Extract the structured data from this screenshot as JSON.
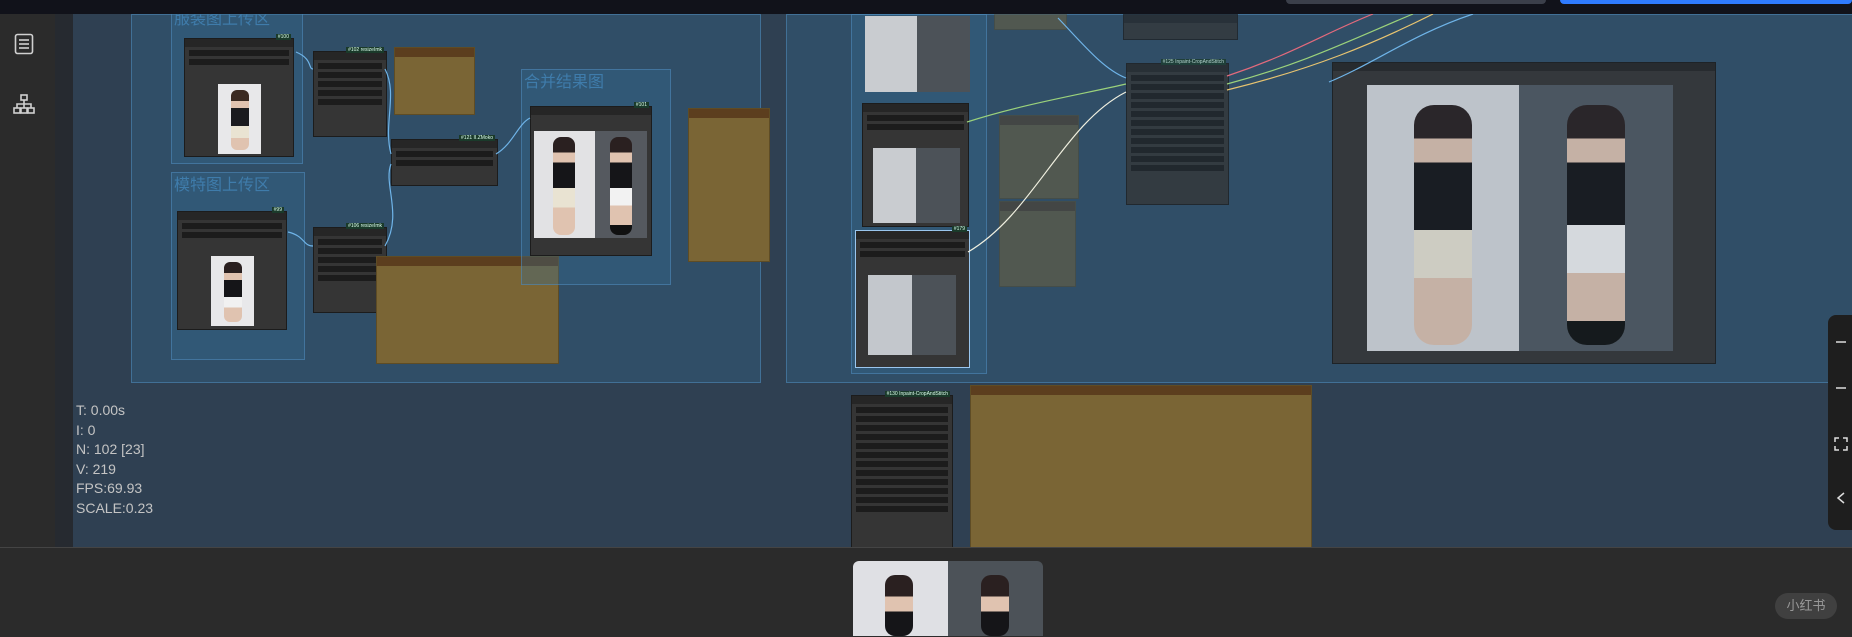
{
  "groups": {
    "model_upload": "模特图上传区",
    "merge_result": "合并结果图",
    "clothing_upload": "服装图上传区"
  },
  "node_tags": {
    "load1": "#100",
    "load2": "#99",
    "resize1": "#102 resizeImk",
    "resize2": "#106 resizeImk",
    "stitch": "#121 II.ZMoko",
    "preview_merge": "#101",
    "inpaint_top": "#125 Inpaint-CropAndStitch",
    "inpaint_bottom": "#130 Inpaint-CropAndStitch",
    "selected_preview": "#179"
  },
  "stats": {
    "t": "T: 0.00s",
    "i": "I: 0",
    "n": "N: 102 [23]",
    "v": "V: 219",
    "fps": "FPS:69.93",
    "scale": "SCALE:0.23"
  },
  "sidebar": {
    "icons": [
      "queue-list-icon",
      "node-library-icon"
    ]
  },
  "right_controls": {
    "icons": [
      "zoom-in-icon",
      "zoom-out-icon",
      "fit-view-icon",
      "collapse-icon"
    ]
  },
  "watermark": "小红书",
  "colors": {
    "canvas": "#2f4052",
    "group": "#346e96",
    "note": "#7a6535",
    "accent": "#2f7bff"
  }
}
